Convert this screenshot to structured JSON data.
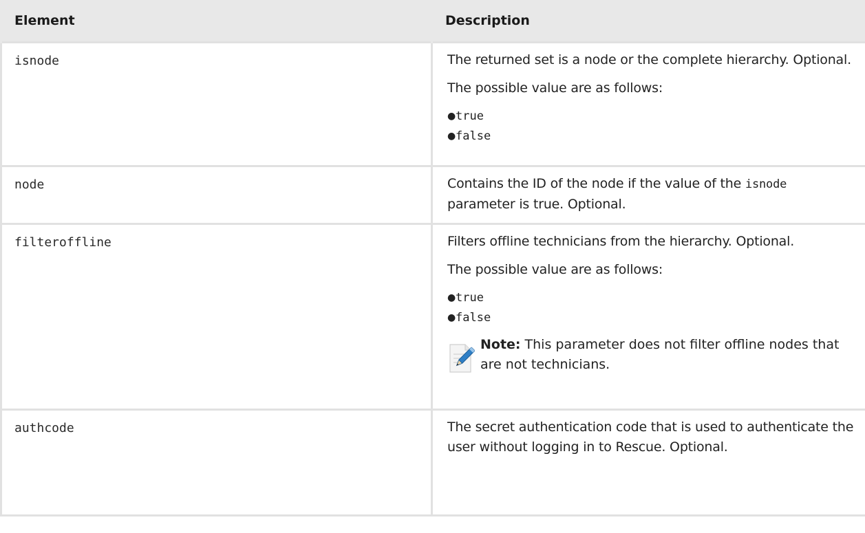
{
  "table": {
    "headers": {
      "element": "Element",
      "description": "Description"
    },
    "rows": [
      {
        "element": "isnode",
        "desc_text": "The returned set is a node or the complete hierarchy. Optional.",
        "values_intro": "The possible value are as follows:",
        "values": [
          "true",
          "false"
        ]
      },
      {
        "element": "node",
        "desc_prefix": "Contains the ID of the node if the value of the",
        "desc_code": "isnode",
        "desc_suffix": "parameter is true. Optional."
      },
      {
        "element": "filteroffline",
        "desc_text": "Filters offline technicians from the hierarchy. Optional.",
        "values_intro": "The possible value are as follows:",
        "values": [
          "true",
          "false"
        ],
        "note_label": "Note:",
        "note_text": "This parameter does not filter offline nodes that are not technicians.",
        "note_icon": "pencil-note-icon"
      },
      {
        "element": "authcode",
        "desc_text": "The secret authentication code that is used to authenticate the user without logging in to Rescue. Optional."
      }
    ]
  },
  "colors": {
    "header_bg": "#e8e8e8",
    "border": "#e1e1e1",
    "text": "#222222"
  }
}
